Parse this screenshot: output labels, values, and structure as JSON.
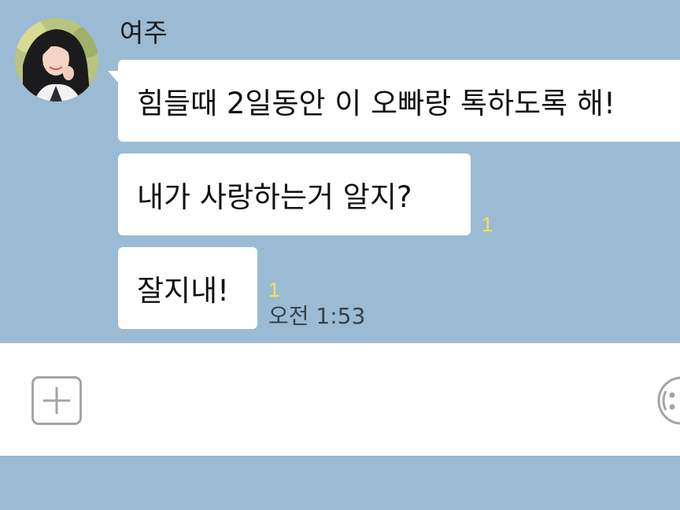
{
  "chat": {
    "sender_name": "여주",
    "messages": [
      {
        "text": "힘들때 2일동안 이 오빠랑 톡하도록 해!",
        "unread": ""
      },
      {
        "text": "내가 사랑하는거 알지?",
        "unread": "1"
      },
      {
        "text": "잘지내!",
        "unread": "1",
        "time": "오전 1:53"
      }
    ]
  },
  "colors": {
    "chat_background": "#9bbbd4",
    "bubble": "#ffffff",
    "unread_count": "#f4e34a",
    "input_bar": "#ffffff"
  },
  "input_bar": {
    "left_icon": "plus-icon",
    "right_icon": "emoji-icon"
  }
}
